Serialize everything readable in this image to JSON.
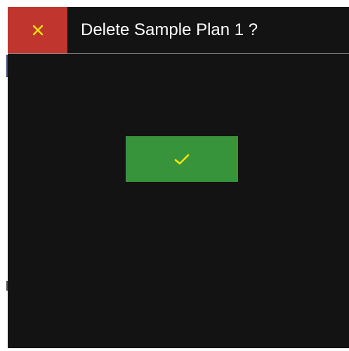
{
  "dialog": {
    "title": "Delete Sample Plan 1 ?",
    "close_icon": "close-icon",
    "confirm_icon": "checkmark-icon"
  },
  "colors": {
    "background": "#131313",
    "header_divider": "#8a8a8a",
    "close_button": "#c0352e",
    "confirm_button": "#37943a",
    "icon": "#f2e600",
    "title_text": "#ffffff"
  }
}
